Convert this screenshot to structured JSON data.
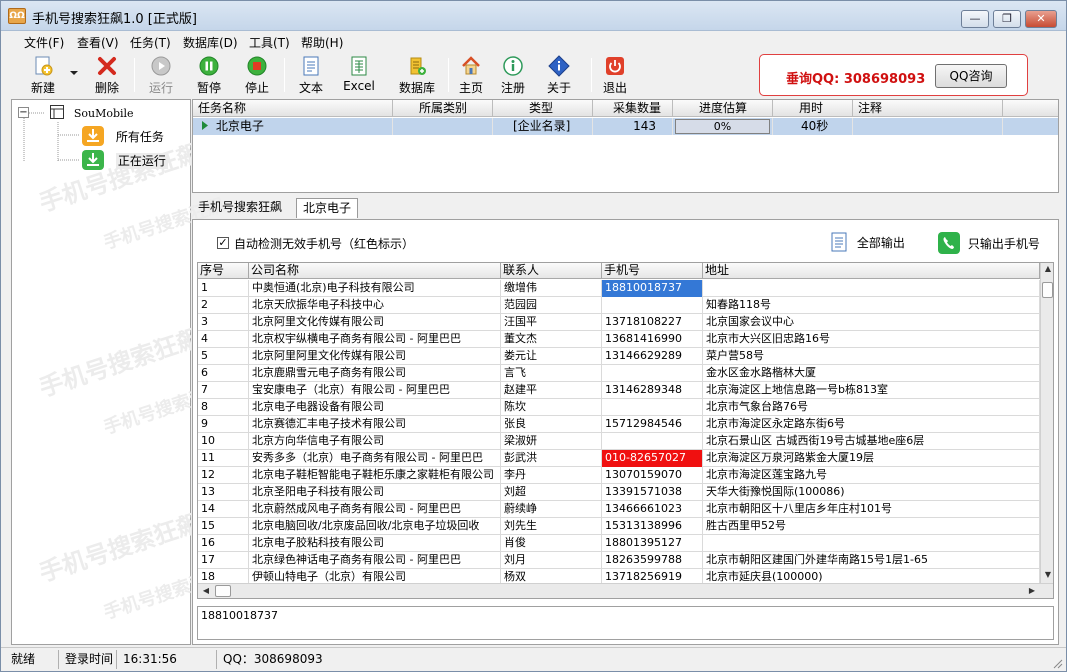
{
  "window": {
    "title": "手机号搜索狂飙1.0 [正式版]",
    "icon": "app-icon",
    "controls": [
      "minimize",
      "maximize",
      "close"
    ]
  },
  "menu": [
    "文件(F)",
    "查看(V)",
    "任务(T)",
    "数据库(D)",
    "工具(T)",
    "帮助(H)"
  ],
  "toolbar": {
    "new": "新建",
    "delete": "删除",
    "run": "运行",
    "pause": "暂停",
    "stop": "停止",
    "text": "文本",
    "excel": "Excel",
    "database": "数据库",
    "home": "主页",
    "register": "注册",
    "about": "关于",
    "exit": "退出"
  },
  "qq_panel": {
    "label": "垂询QQ: 308698093",
    "button": "QQ咨询"
  },
  "tree": {
    "root": "SouMobile",
    "items": [
      "所有任务",
      "正在运行"
    ]
  },
  "watermark": "手机号搜索狂飙",
  "task_table": {
    "headers": [
      "任务名称",
      "所属类别",
      "类型",
      "采集数量",
      "进度估算",
      "用时",
      "注释"
    ],
    "rows": [
      {
        "name": "北京电子",
        "category": "",
        "type": "[企业名录]",
        "count": "143",
        "progress": "0%",
        "time": "40秒",
        "note": ""
      }
    ]
  },
  "tabs": [
    "手机号搜索狂飙",
    "北京电子"
  ],
  "options": {
    "auto_check": "自动检测无效手机号（红色标示）",
    "export_all": "全部输出",
    "export_mobile": "只输出手机号"
  },
  "results": {
    "headers": [
      "序号",
      "公司名称",
      "联系人",
      "手机号",
      "地址"
    ],
    "rows": [
      [
        "1",
        "中奥恒通(北京)电子科技有限公司",
        "缴增伟",
        "18810018737",
        ""
      ],
      [
        "2",
        "北京天欣振华电子科技中心",
        "范园园",
        "",
        "知春路118号"
      ],
      [
        "3",
        "北京阿里文化传媒有限公司",
        "汪国平",
        "13718108227",
        "北京国家会议中心"
      ],
      [
        "4",
        "北京权宇纵横电子商务有限公司 - 阿里巴巴",
        "董文杰",
        "13681416990",
        "北京市大兴区旧忠路16号"
      ],
      [
        "5",
        "北京阿里阿里文化传媒有限公司",
        "娄元让",
        "13146629289",
        "菜户营58号"
      ],
      [
        "6",
        "北京鹿鼎雪元电子商务有限公司",
        "言飞",
        "",
        "金水区金水路楷林大厦"
      ],
      [
        "7",
        "宝安康电子（北京）有限公司 - 阿里巴巴",
        "赵建平",
        "13146289348",
        "北京海淀区上地信息路一号b栋813室"
      ],
      [
        "8",
        "北京电子电器设备有限公司",
        "陈坎",
        "",
        "北京市气象台路76号"
      ],
      [
        "9",
        "北京赛德汇丰电子技术有限公司",
        "张良",
        "15712984546",
        "北京市海淀区永定路东街6号"
      ],
      [
        "10",
        "北京方向华信电子有限公司",
        "梁淑妍",
        "",
        "北京石景山区 古城西街19号古城基地e座6层"
      ],
      [
        "11",
        "安秀多多（北京）电子商务有限公司 - 阿里巴巴",
        "彭武洪",
        "010-82657027",
        "北京海淀区万泉河路紫金大厦19层"
      ],
      [
        "12",
        "北京电子鞋柜智能电子鞋柜乐康之家鞋柜有限公司",
        "李丹",
        "13070159070",
        "北京市海淀区莲宝路九号"
      ],
      [
        "13",
        "北京圣阳电子科技有限公司",
        "刘超",
        "13391571038",
        "天华大街豫悦国际(100086)"
      ],
      [
        "14",
        "北京蔚然成风电子商务有限公司 - 阿里巴巴",
        "蔚续峥",
        "13466661023",
        "北京市朝阳区十八里店乡年庄村101号"
      ],
      [
        "15",
        "北京电脑回收/北京废品回收/北京电子垃圾回收",
        "刘先生",
        "15313138996",
        "胜古西里甲52号"
      ],
      [
        "16",
        "北京电子胶粘科技有限公司",
        "肖俊",
        "18801395127",
        ""
      ],
      [
        "17",
        "北京绿色神话电子商务有限公司 - 阿里巴巴",
        "刘月",
        "18263599788",
        "北京市朝阳区建国门外建华南路15号1层1-65"
      ],
      [
        "18",
        "伊顿山特电子（北京）有限公司",
        "杨双",
        "13718256919",
        "北京市延庆县(100000)"
      ]
    ],
    "selected_phone_row": 1,
    "invalid_phone_row": 11
  },
  "detail_text": "18810018737",
  "status": {
    "ready": "就绪",
    "login_label": "登录时间",
    "login_time": "16:31:56",
    "qq": "QQ：308698093"
  },
  "colors": {
    "selection": "#3478d6",
    "invalid": "#f01010",
    "task_row": "#c0d4ec",
    "qq_red": "#d01010"
  }
}
